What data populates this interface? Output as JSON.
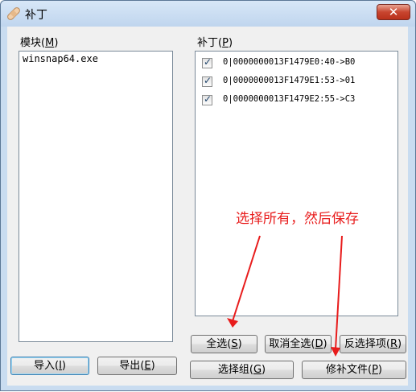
{
  "window": {
    "title": "补丁",
    "close_symbol": "✕"
  },
  "modules": {
    "label": "模块",
    "label_key": "M",
    "items": [
      "winsnap64.exe"
    ]
  },
  "patches": {
    "label": "补丁",
    "label_key": "P",
    "items": [
      {
        "checked": true,
        "text": "0|0000000013F1479E0:40->B0"
      },
      {
        "checked": true,
        "text": "0|0000000013F1479E1:53->01"
      },
      {
        "checked": true,
        "text": "0|0000000013F1479E2:55->C3"
      }
    ]
  },
  "buttons": {
    "import": {
      "label": "导入",
      "key": "I"
    },
    "export": {
      "label": "导出",
      "key": "E"
    },
    "select_all": {
      "label": "全选",
      "key": "S"
    },
    "deselect_all": {
      "label": "取消全选",
      "key": "D"
    },
    "invert": {
      "label": "反选择项",
      "key": "R"
    },
    "select_group": {
      "label": "选择组",
      "key": "G"
    },
    "patch_file": {
      "label": "修补文件",
      "key": "P"
    }
  },
  "annotation": {
    "text": "选择所有，然后保存",
    "color": "#e81c1c"
  }
}
